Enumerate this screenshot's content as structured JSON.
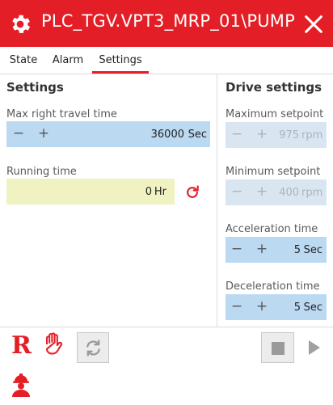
{
  "window": {
    "title": "PLC_TGV.VPT3_MRP_01\\PUMP",
    "accent_color": "#e41e26",
    "icons": [
      "gear-icon",
      "close-icon"
    ]
  },
  "tabs": [
    {
      "label": "State",
      "active": false
    },
    {
      "label": "Alarm",
      "active": false
    },
    {
      "label": "Settings",
      "active": true
    }
  ],
  "settings": {
    "title": "Settings",
    "max_right_travel": {
      "label": "Max right travel time",
      "value": "36000",
      "unit": "Sec",
      "minus": "−",
      "plus": "+"
    },
    "running_time": {
      "label": "Running time",
      "value": "0",
      "unit": "Hr"
    }
  },
  "drive": {
    "title": "Drive settings",
    "max_setpoint": {
      "label": "Maximum setpoint",
      "value": "975",
      "unit": "rpm",
      "minus": "−",
      "plus": "+"
    },
    "min_setpoint": {
      "label": "Minimum setpoint",
      "value": "400",
      "unit": "rpm",
      "minus": "−",
      "plus": "+"
    },
    "acceleration": {
      "label": "Acceleration time",
      "value": "5",
      "unit": "Sec",
      "minus": "−",
      "plus": "+"
    },
    "deceleration": {
      "label": "Deceleration time",
      "value": "5",
      "unit": "Sec",
      "minus": "−",
      "plus": "+"
    }
  },
  "toolbar": {
    "remote_label": "R",
    "icons": [
      "hand-icon",
      "sync-icon",
      "stop-icon",
      "play-icon",
      "operator-icon"
    ]
  }
}
